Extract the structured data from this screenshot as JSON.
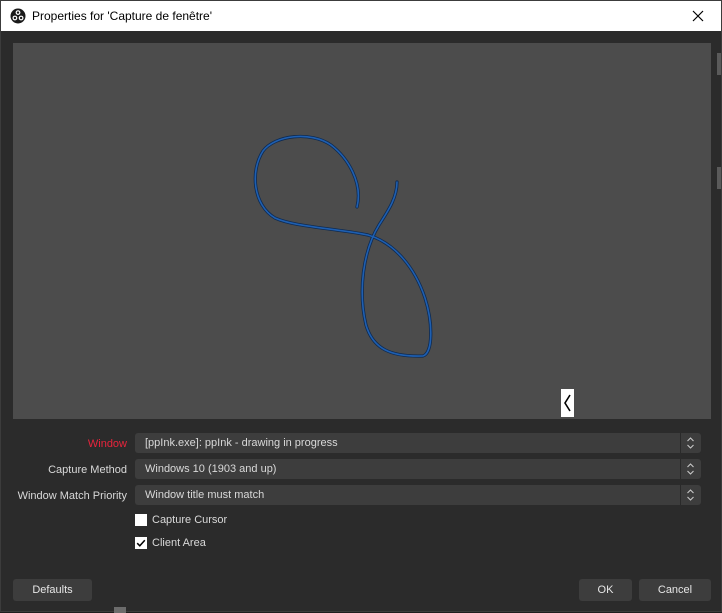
{
  "window": {
    "title": "Properties for 'Capture de fenêtre'"
  },
  "icons": {
    "app": "obs-logo-icon",
    "close": "close-icon",
    "expand": "chevron-left-icon",
    "combo_arrows": "updown-arrows-icon",
    "check": "checkmark-icon"
  },
  "colors": {
    "required_label": "#e8243c",
    "ink_stroke": "#1f5fb0",
    "preview_bg": "#4c4c4c",
    "dialog_bg": "#2b2b2b"
  },
  "form": {
    "window": {
      "label": "Window",
      "value": "[ppInk.exe]: ppInk - drawing in progress"
    },
    "capture_method": {
      "label": "Capture Method",
      "value": "Windows 10 (1903 and up)"
    },
    "match_priority": {
      "label": "Window Match Priority",
      "value": "Window title must match"
    },
    "capture_cursor": {
      "label": "Capture Cursor",
      "checked": false
    },
    "client_area": {
      "label": "Client Area",
      "checked": true
    }
  },
  "buttons": {
    "defaults": "Defaults",
    "ok": "OK",
    "cancel": "Cancel"
  }
}
